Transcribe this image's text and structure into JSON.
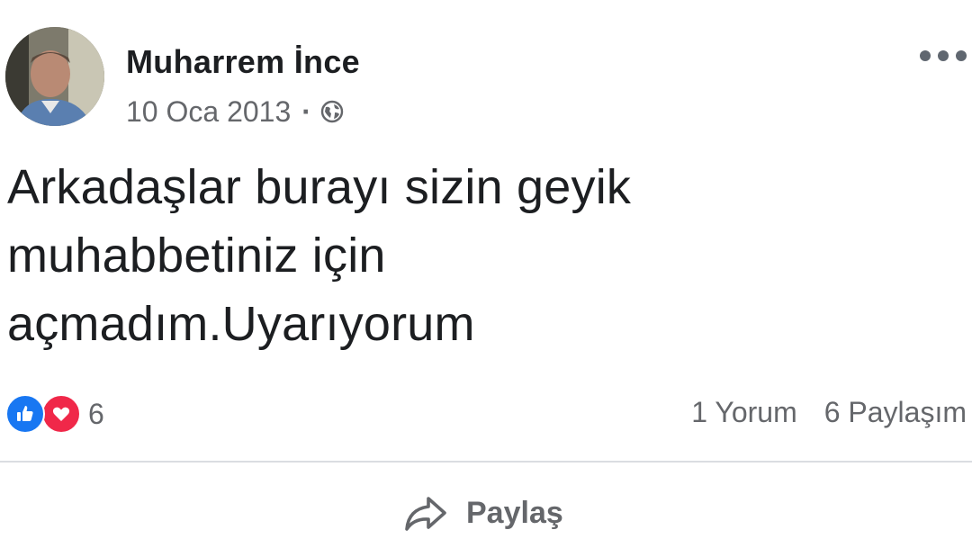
{
  "post": {
    "author": "Muharrem İnce",
    "date": "10 Oca 2013",
    "separator": "·",
    "audience_icon": "globe-icon",
    "menu_icon": "more-horizontal-icon",
    "text_lines": [
      "Arkadaşlar burayı sizin geyik",
      "muhabbetiniz için",
      "açmadım.Uyarıyorum"
    ]
  },
  "reactions": {
    "icons": [
      "like-icon",
      "love-icon"
    ],
    "count": "6"
  },
  "stats": {
    "comments": "1 Yorum",
    "shares": "6 Paylaşım"
  },
  "actions": {
    "share_label": "Paylaş",
    "share_icon": "share-arrow-icon"
  },
  "colors": {
    "like": "#1877f2",
    "love": "#f02849",
    "secondary_text": "#65676b",
    "divider": "#dadde1"
  }
}
